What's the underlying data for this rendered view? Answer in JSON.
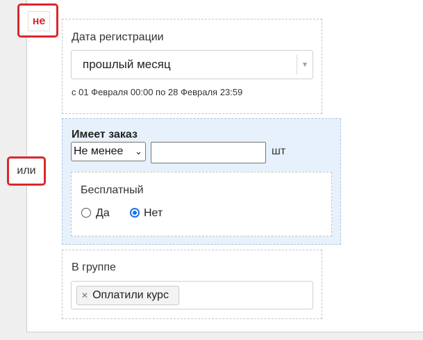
{
  "logic": {
    "not_label": "не",
    "or_label": "или"
  },
  "registration": {
    "label": "Дата регистрации",
    "selected": "прошлый месяц",
    "range": "с 01 Февраля 00:00 по 28 Февраля 23:59"
  },
  "order": {
    "label": "Имеет заказ",
    "operator": "Не менее",
    "quantity": "",
    "unit": "шт",
    "free": {
      "label": "Бесплатный",
      "options": [
        "Да",
        "Нет"
      ],
      "selected": "Нет"
    }
  },
  "group": {
    "label": "В группе",
    "tags": [
      "Оплатили курс"
    ]
  },
  "colors": {
    "accent": "#d8282c",
    "highlight_bg": "#e6f1fc",
    "radio": "#1a73e8"
  }
}
